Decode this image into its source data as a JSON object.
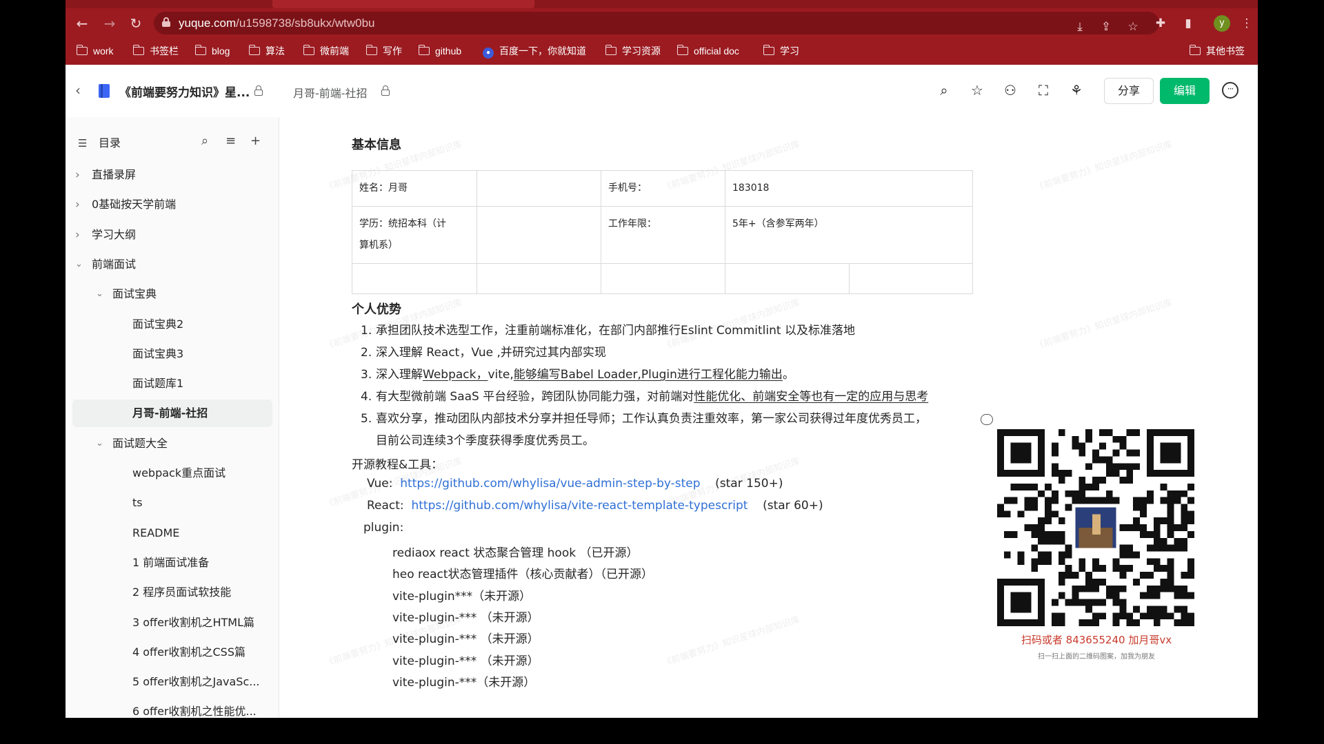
{
  "browser": {
    "url_host": "yuque.com",
    "url_path": "/u1598738/sb8ukx/wtw0bu",
    "avatar_letter": "y",
    "bookmarks": [
      "work",
      "书签栏",
      "blog",
      "算法",
      "微前端",
      "写作",
      "github",
      "百度一下，你就知道",
      "学习资源",
      "official doc",
      "学习"
    ],
    "other_bookmarks": "其他书签"
  },
  "header": {
    "book_title": "《前端要努力知识》星...",
    "doc_path": "月哥-前端-社招",
    "share_label": "分享",
    "edit_label": "编辑"
  },
  "sidebar": {
    "toc_label": "目录",
    "items": [
      {
        "label": "直播录屏",
        "level": 0,
        "caret": "right"
      },
      {
        "label": "0基础按天学前端",
        "level": 0,
        "caret": "right"
      },
      {
        "label": "学习大纲",
        "level": 0,
        "caret": "right"
      },
      {
        "label": "前端面试",
        "level": 0,
        "caret": "down"
      },
      {
        "label": "面试宝典",
        "level": 1,
        "caret": "down"
      },
      {
        "label": "面试宝典2",
        "level": 2,
        "caret": ""
      },
      {
        "label": "面试宝典3",
        "level": 2,
        "caret": ""
      },
      {
        "label": "面试题库1",
        "level": 2,
        "caret": ""
      },
      {
        "label": "月哥-前端-社招",
        "level": 2,
        "caret": "",
        "active": true
      },
      {
        "label": "面试题大全",
        "level": 1,
        "caret": "down"
      },
      {
        "label": "webpack重点面试",
        "level": 2,
        "caret": ""
      },
      {
        "label": "ts",
        "level": 2,
        "caret": ""
      },
      {
        "label": "README",
        "level": 2,
        "caret": ""
      },
      {
        "label": "1 前端面试准备",
        "level": 2,
        "caret": ""
      },
      {
        "label": "2 程序员面试软技能",
        "level": 2,
        "caret": ""
      },
      {
        "label": "3 offer收割机之HTML篇",
        "level": 2,
        "caret": ""
      },
      {
        "label": "4 offer收割机之CSS篇",
        "level": 2,
        "caret": ""
      },
      {
        "label": "5 offer收割机之JavaSc...",
        "level": 2,
        "caret": ""
      },
      {
        "label": "6 offer收割机之性能优...",
        "level": 2,
        "caret": ""
      }
    ]
  },
  "doc": {
    "basic_info_title": "基本信息",
    "table": {
      "name_label": "姓名：月哥",
      "phone_label": "手机号：",
      "phone_value": "183018",
      "edu_label_1": "学历：统招本科（计",
      "edu_label_2": "算机系）",
      "years_label": "工作年限：",
      "years_value": "5年+（含参军两年）"
    },
    "advantage_title": "个人优势",
    "advantages": {
      "a1": "承担团队技术选型工作，注重前端标准化，在部门内部推行Eslint  Commitlint 以及标准落地",
      "a2": "深入理解 React，Vue ,并研究过其内部实现",
      "a3_pre": "深入理解",
      "a3_u1": "Webpack，",
      "a3_mid": "vite,",
      "a3_u2": "能够编写Babel Loader,Plugin进行工程化能力输出",
      "a3_post": "。",
      "a4_pre": "有大型微前端 SaaS 平台经验，跨团队协同能力强，对前端对",
      "a4_u": "性能优化、前端安全等也有一定的应用与思考",
      "a5_line1": "喜欢分享，推动团队内部技术分享并担任导师；工作认真负责注重效率，第一家公司获得过年度优秀员工，",
      "a5_line2": "目前公司连续3个季度获得季度优秀员工。"
    },
    "oss_title": "开源教程&工具：",
    "vue_label": "Vue:",
    "vue_url": "https://github.com/whylisa/vue-admin-step-by-step",
    "vue_star": "(star 150+)",
    "react_label": "React:",
    "react_url": "https://github.com/whylisa/vite-react-template-typescript",
    "react_star": "(star 60+)",
    "plugin_label": "plugin:",
    "plugins": [
      "rediaox react 状态聚合管理 hook （已开源）",
      "heo react状态管理插件（核心贡献者）（已开源）",
      "vite-plugin***（未开源）",
      "vite-plugin-*** （未开源）",
      "vite-plugin-*** （未开源）",
      "vite-plugin-*** （未开源）",
      "vite-plugin-***（未开源）"
    ],
    "watermark": "《前端要努力》知识星球内部知识库"
  },
  "qr": {
    "caption": "扫码或者 843655240 加月哥vx",
    "sub": "扫一扫上面的二维码图案，加我为朋友"
  },
  "colors": {
    "chrome": "#9b1b21",
    "edit_button": "#00b96b",
    "link": "#2f6fd6",
    "qr_caption": "#c83a2b"
  }
}
